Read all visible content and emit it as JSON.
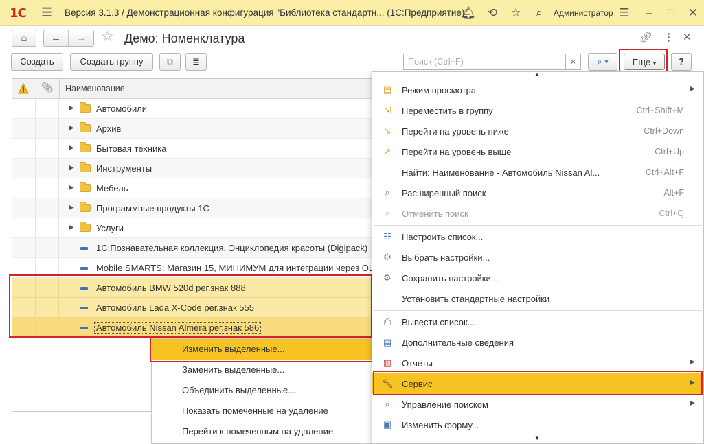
{
  "window": {
    "logo": "1С",
    "title": "Версия 3.1.3 / Демонстрационная конфигурация \"Библиотека стандартн...  (1С:Предприятие)",
    "user": "Администратор"
  },
  "page": {
    "title": "Демо: Номенклатура"
  },
  "toolbar": {
    "create_label": "Создать",
    "create_group_label": "Создать группу",
    "search_placeholder": "Поиск (Ctrl+F)",
    "search_clear": "×",
    "more_label": "Еще",
    "help_label": "?"
  },
  "table": {
    "header_name": "Наименование",
    "rows": [
      {
        "kind": "folder",
        "text": "Автомобили"
      },
      {
        "kind": "folder",
        "text": "Архив"
      },
      {
        "kind": "folder",
        "text": "Бытовая техника"
      },
      {
        "kind": "folder",
        "text": "Инструменты"
      },
      {
        "kind": "folder",
        "text": "Мебель"
      },
      {
        "kind": "folder",
        "text": "Программные продукты 1С"
      },
      {
        "kind": "folder",
        "text": "Услуги"
      },
      {
        "kind": "item",
        "text": "1С:Познавательная коллекция. Энциклопедия красоты (Digipack)"
      },
      {
        "kind": "item",
        "text": "Mobile SMARTS: Магазин 15, МИНИМУМ для интеграции через OLE"
      },
      {
        "kind": "item",
        "text": "Автомобиль BMW 520d рег.знак 888",
        "selected": true
      },
      {
        "kind": "item",
        "text": "Автомобиль Lada X-Code рег.знак 555",
        "selected": true
      },
      {
        "kind": "item",
        "text": "Автомобиль Nissan Almera рег.знак 586",
        "selected": true,
        "current": true
      }
    ]
  },
  "submenu": {
    "items": [
      {
        "label": "Изменить выделенные...",
        "highlighted": true
      },
      {
        "label": "Заменить выделенные..."
      },
      {
        "label": "Объединить выделенные..."
      },
      {
        "label": "Показать помеченные на удаление"
      },
      {
        "label": "Перейти к помеченным на удаление"
      }
    ]
  },
  "menu": {
    "items": [
      {
        "label": "Режим просмотра",
        "shortcut": "",
        "submenu": true,
        "icon": "view-mode-icon"
      },
      {
        "label": "Переместить в группу",
        "shortcut": "Ctrl+Shift+M",
        "icon": "move-to-group-icon"
      },
      {
        "label": "Перейти на уровень ниже",
        "shortcut": "Ctrl+Down",
        "icon": "level-down-icon"
      },
      {
        "label": "Перейти на уровень выше",
        "shortcut": "Ctrl+Up",
        "icon": "level-up-icon"
      },
      {
        "label": "Найти: Наименование - Автомобиль Nissan Al...",
        "shortcut": "Ctrl+Alt+F",
        "icon": ""
      },
      {
        "label": "Расширенный поиск",
        "shortcut": "Alt+F",
        "icon": "advanced-search-icon"
      },
      {
        "label": "Отменить поиск",
        "shortcut": "Ctrl+Q",
        "disabled": true,
        "icon": "cancel-search-icon"
      },
      {
        "label": "Настроить список...",
        "shortcut": "",
        "icon": "configure-list-icon"
      },
      {
        "label": "Выбрать настройки...",
        "shortcut": "",
        "icon": "select-settings-icon"
      },
      {
        "label": "Сохранить настройки...",
        "shortcut": "",
        "icon": "save-settings-icon"
      },
      {
        "label": "Установить стандартные настройки",
        "shortcut": "",
        "icon": ""
      },
      {
        "label": "Вывести список...",
        "shortcut": "",
        "icon": "print-list-icon"
      },
      {
        "label": "Дополнительные сведения",
        "shortcut": "",
        "icon": "additional-info-icon"
      },
      {
        "label": "Отчеты",
        "shortcut": "",
        "submenu": true,
        "icon": "reports-icon"
      },
      {
        "label": "Сервис",
        "shortcut": "",
        "submenu": true,
        "highlighted": true,
        "icon": "wrench-icon"
      },
      {
        "label": "Управление поиском",
        "shortcut": "",
        "submenu": true,
        "icon": "search-management-icon"
      },
      {
        "label": "Изменить форму...",
        "shortcut": "",
        "icon": "change-form-icon"
      }
    ]
  },
  "colors": {
    "titlebar": "#fbeea6",
    "highlight": "#f6c323",
    "selected_row": "#fbe9a6",
    "annotation_red": "#d6222b"
  }
}
